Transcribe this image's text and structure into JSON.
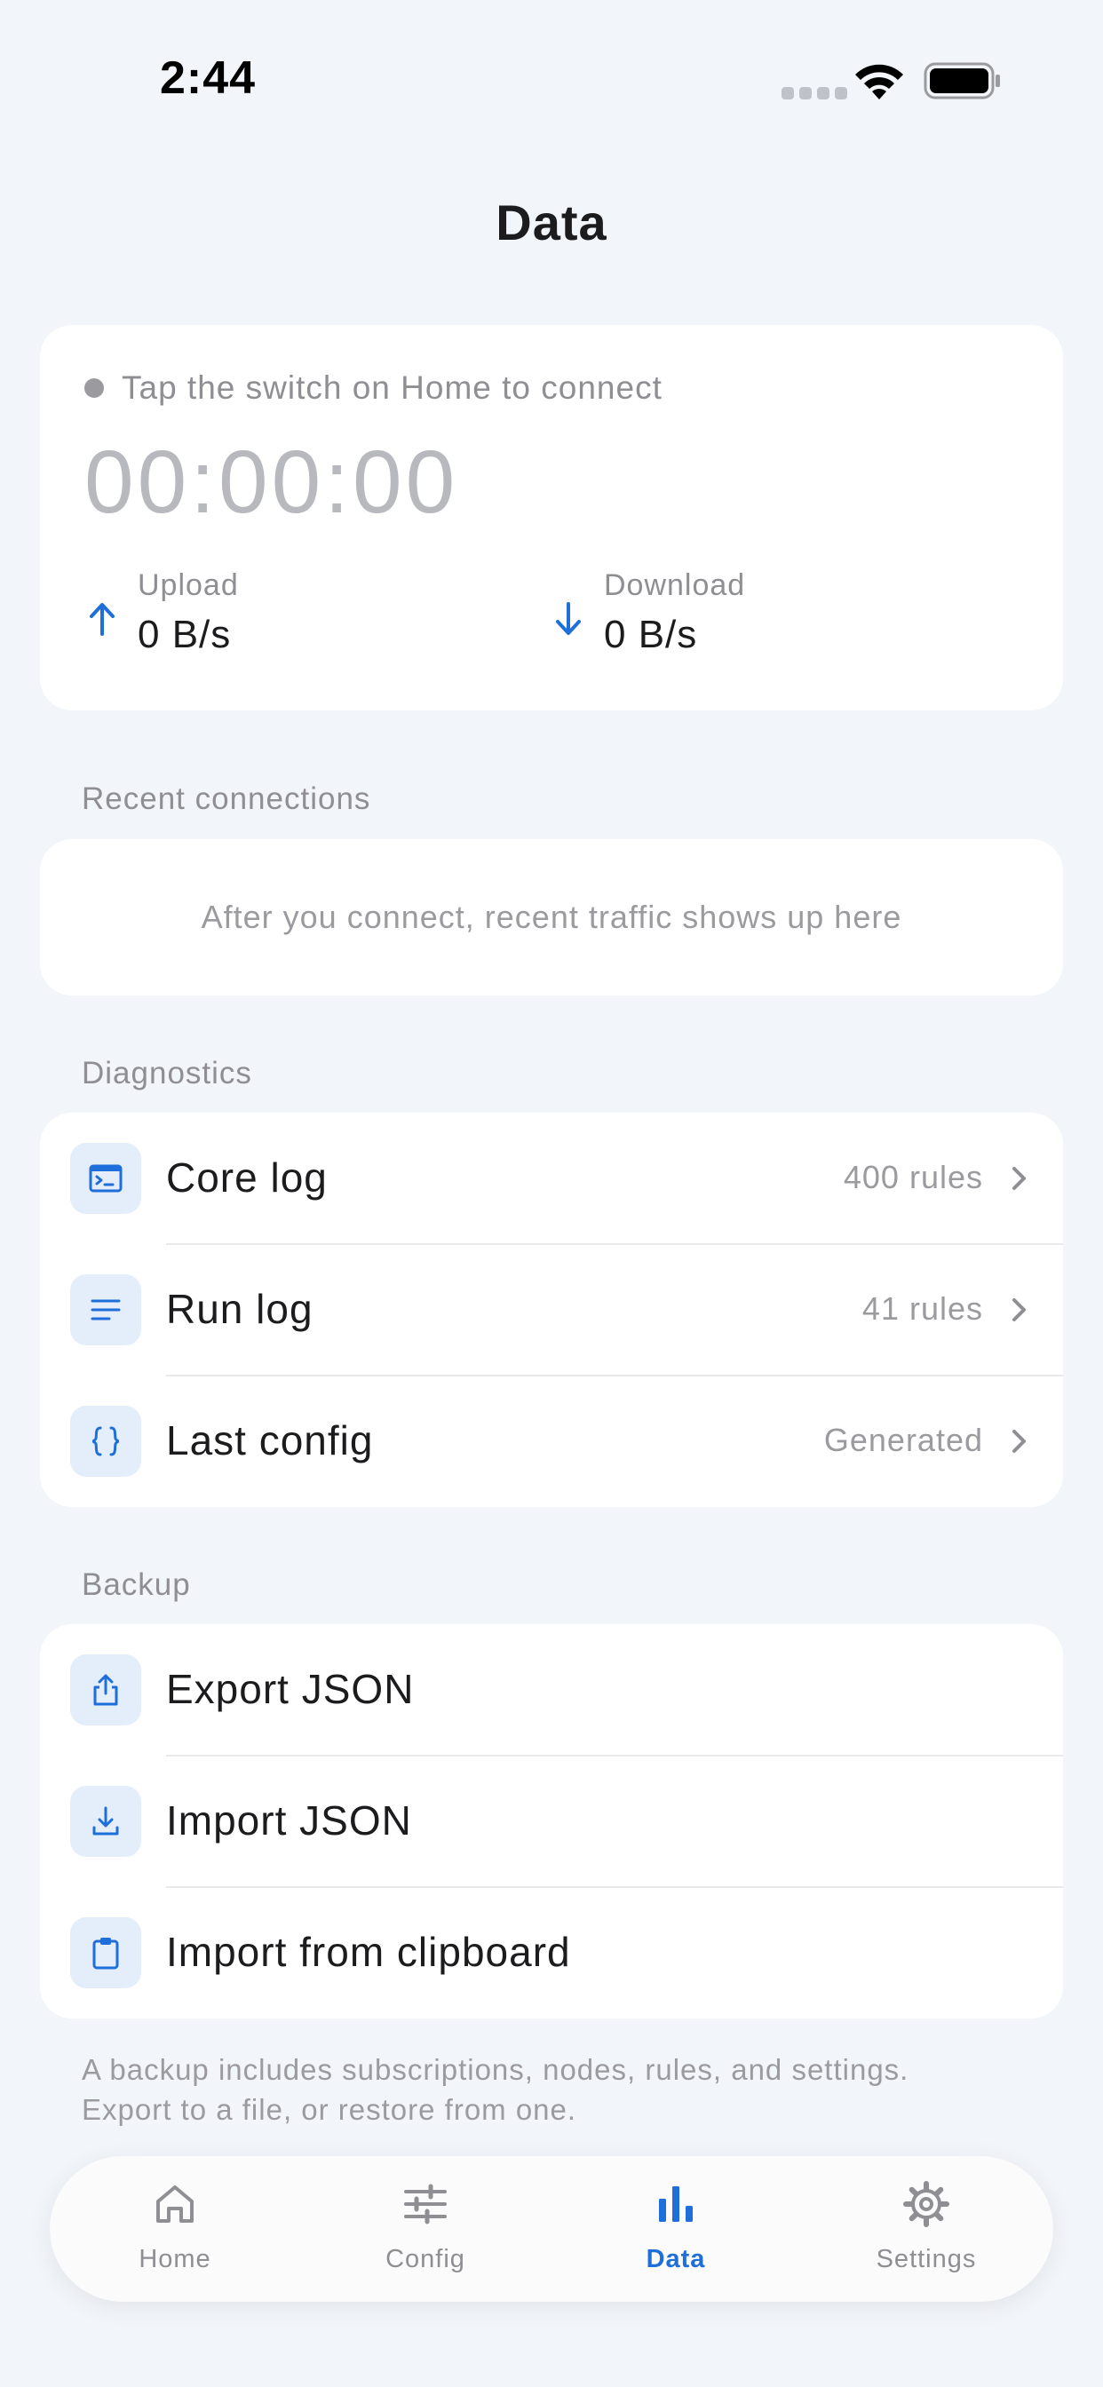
{
  "status_bar": {
    "time": "2:44"
  },
  "title": "Data",
  "connection": {
    "status": "Tap the switch on Home to connect",
    "timer": "00:00:00",
    "upload": {
      "label": "Upload",
      "value": "0 B/s",
      "icon": "arrow-up-icon"
    },
    "download": {
      "label": "Download",
      "value": "0 B/s",
      "icon": "arrow-down-icon"
    }
  },
  "recent": {
    "section_label": "Recent connections",
    "empty_message": "After you connect, recent traffic shows up here"
  },
  "diagnostics": {
    "section_label": "Diagnostics",
    "items": [
      {
        "label": "Core log",
        "value": "400 rules",
        "icon": "terminal-icon"
      },
      {
        "label": "Run log",
        "value": "41 rules",
        "icon": "lines-icon"
      },
      {
        "label": "Last config",
        "value": "Generated",
        "icon": "braces-icon"
      }
    ]
  },
  "backup": {
    "section_label": "Backup",
    "items": [
      {
        "label": "Export JSON",
        "icon": "share-icon"
      },
      {
        "label": "Import JSON",
        "icon": "download-icon"
      },
      {
        "label": "Import from clipboard",
        "icon": "clipboard-icon"
      }
    ],
    "note_line1": "A backup includes subscriptions, nodes, rules, and settings.",
    "note_line2": "Export to a file, or restore from one."
  },
  "tabs": [
    {
      "label": "Home",
      "icon": "house-icon",
      "active": false
    },
    {
      "label": "Config",
      "icon": "sliders-icon",
      "active": false
    },
    {
      "label": "Data",
      "icon": "bar-chart-icon",
      "active": true
    },
    {
      "label": "Settings",
      "icon": "gear-icon",
      "active": false
    }
  ],
  "colors": {
    "accent": "#1E6FD9",
    "background": "#F2F5FA",
    "card": "#FFFFFF",
    "icon_tile": "#E4EEFB",
    "secondary_text": "#8E8E93"
  }
}
